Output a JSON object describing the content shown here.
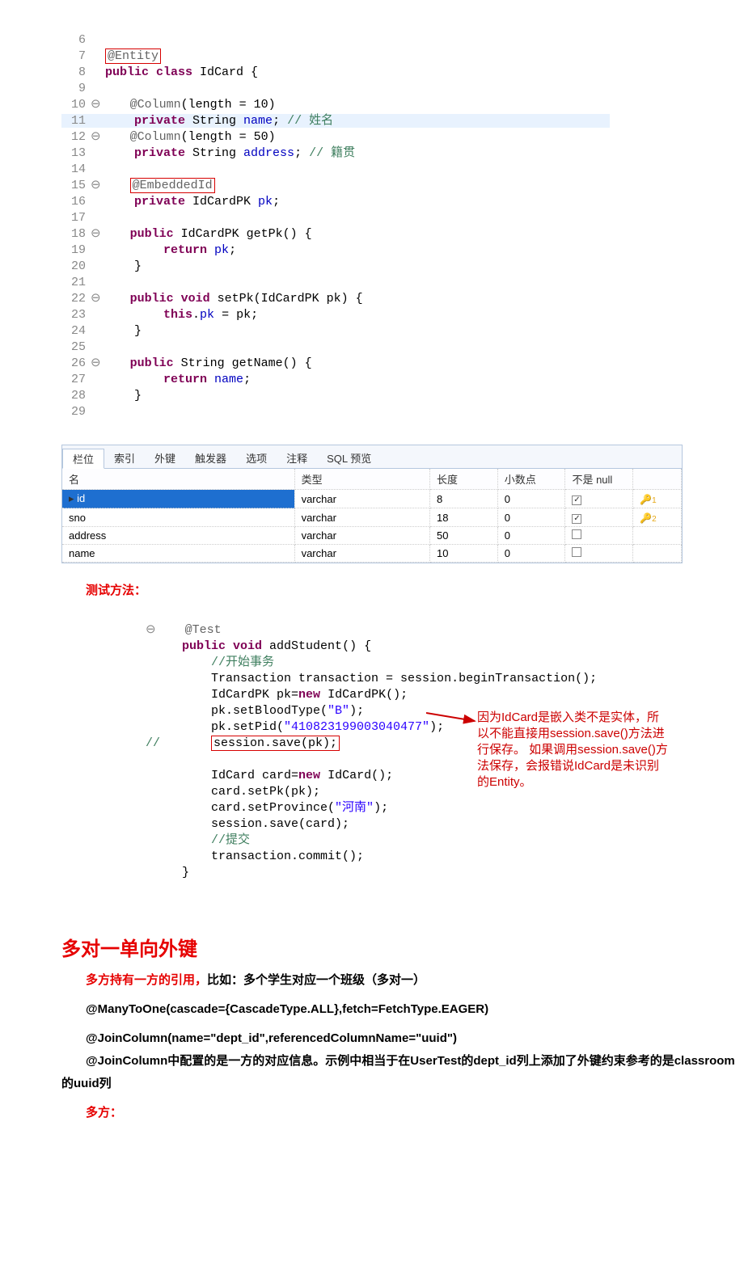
{
  "code1": {
    "lines": [
      {
        "n": "6",
        "c": ""
      },
      {
        "n": "7",
        "c": "@Entity",
        "ann": true,
        "box": true
      },
      {
        "n": "8",
        "c": "public class IdCard {",
        "kw": [
          "public",
          "class"
        ]
      },
      {
        "n": "9",
        "c": ""
      },
      {
        "n": "10",
        "fold": "⊖",
        "c": "    @Column(length = 10)",
        "ann_part": "@Column"
      },
      {
        "n": "11",
        "hl": true,
        "c": "    private String name; // 姓名",
        "kw": [
          "private"
        ],
        "fld": "name",
        "com": "// 姓名"
      },
      {
        "n": "12",
        "fold": "⊖",
        "c": "    @Column(length = 50)",
        "ann_part": "@Column"
      },
      {
        "n": "13",
        "c": "    private String address; // 籍贯",
        "kw": [
          "private"
        ],
        "fld": "address",
        "com": "// 籍贯"
      },
      {
        "n": "14",
        "c": ""
      },
      {
        "n": "15",
        "fold": "⊖",
        "c": "    @EmbeddedId",
        "ann": true,
        "box": true
      },
      {
        "n": "16",
        "c": "    private IdCardPK pk;",
        "kw": [
          "private"
        ],
        "fld": "pk"
      },
      {
        "n": "17",
        "c": ""
      },
      {
        "n": "18",
        "fold": "⊖",
        "c": "    public IdCardPK getPk() {",
        "kw": [
          "public"
        ]
      },
      {
        "n": "19",
        "c": "        return pk;",
        "kw": [
          "return"
        ],
        "fld": "pk"
      },
      {
        "n": "20",
        "c": "    }"
      },
      {
        "n": "21",
        "c": ""
      },
      {
        "n": "22",
        "fold": "⊖",
        "c": "    public void setPk(IdCardPK pk) {",
        "kw": [
          "public",
          "void"
        ]
      },
      {
        "n": "23",
        "c": "        this.pk = pk;",
        "kw": [
          "this"
        ],
        "fld": "pk"
      },
      {
        "n": "24",
        "c": "    }"
      },
      {
        "n": "25",
        "c": ""
      },
      {
        "n": "26",
        "fold": "⊖",
        "c": "    public String getName() {",
        "kw": [
          "public"
        ]
      },
      {
        "n": "27",
        "c": "        return name;",
        "kw": [
          "return"
        ],
        "fld": "name"
      },
      {
        "n": "28",
        "c": "    }"
      },
      {
        "n": "29",
        "c": ""
      }
    ]
  },
  "db": {
    "tabs": [
      "栏位",
      "索引",
      "外键",
      "触发器",
      "选项",
      "注释",
      "SQL 预览"
    ],
    "headers": [
      "名",
      "类型",
      "长度",
      "小数点",
      "不是 null",
      ""
    ],
    "rows": [
      {
        "name": "id",
        "type": "varchar",
        "len": "8",
        "dec": "0",
        "nn": true,
        "key": "1",
        "sel": true
      },
      {
        "name": "sno",
        "type": "varchar",
        "len": "18",
        "dec": "0",
        "nn": true,
        "key": "2"
      },
      {
        "name": "address",
        "type": "varchar",
        "len": "50",
        "dec": "0",
        "nn": false
      },
      {
        "name": "name",
        "type": "varchar",
        "len": "10",
        "dec": "0",
        "nn": false
      }
    ]
  },
  "test_title": "测试方法：",
  "test_code": {
    "at_test": "@Test",
    "sig": "public void addStudent() {",
    "c1": "//开始事务",
    "l1": "Transaction transaction = session.beginTransaction();",
    "l2_pre": "IdCardPK pk=",
    "l2_new": "new",
    "l2_post": " IdCardPK();",
    "l3": "pk.setBloodType(",
    "l3s": "\"B\"",
    "l3e": ");",
    "l4": "pk.setPid(",
    "l4s": "\"410823199003040477\"",
    "l4e": ");",
    "cm": "//",
    "boxed": "session.save(pk);",
    "l5_pre": "IdCard card=",
    "l5_new": "new",
    "l5_post": " IdCard();",
    "l6": "card.setPk(pk);",
    "l7": "card.setProvince(",
    "l7s": "\"河南\"",
    "l7e": ");",
    "l8": "session.save(card);",
    "c2": "//提交",
    "l9": "transaction.commit();",
    "close": "}"
  },
  "callout": "因为IdCard是嵌入类不是实体，所以不能直接用session.save()方法进行保存。\n如果调用session.save()方法保存，会报错说IdCard是未识别的Entity。",
  "section_h": "多对一单向外键",
  "p1_red": "多方持有一方的引用，",
  "p1_rest": "比如：多个学生对应一个班级（多对一）",
  "p2": "@ManyToOne(cascade={CascadeType.ALL},fetch=FetchType.EAGER)",
  "p3": "@JoinColumn(name=\"dept_id\",referencedColumnName=\"uuid\")",
  "p4_red": "@JoinColumn中配置的是一方的对应信息。",
  "p4_rest": "示例中相当于在UserTest的dept_id列上添加了外键约束参考的是classroom的uuid列",
  "p5": "多方："
}
